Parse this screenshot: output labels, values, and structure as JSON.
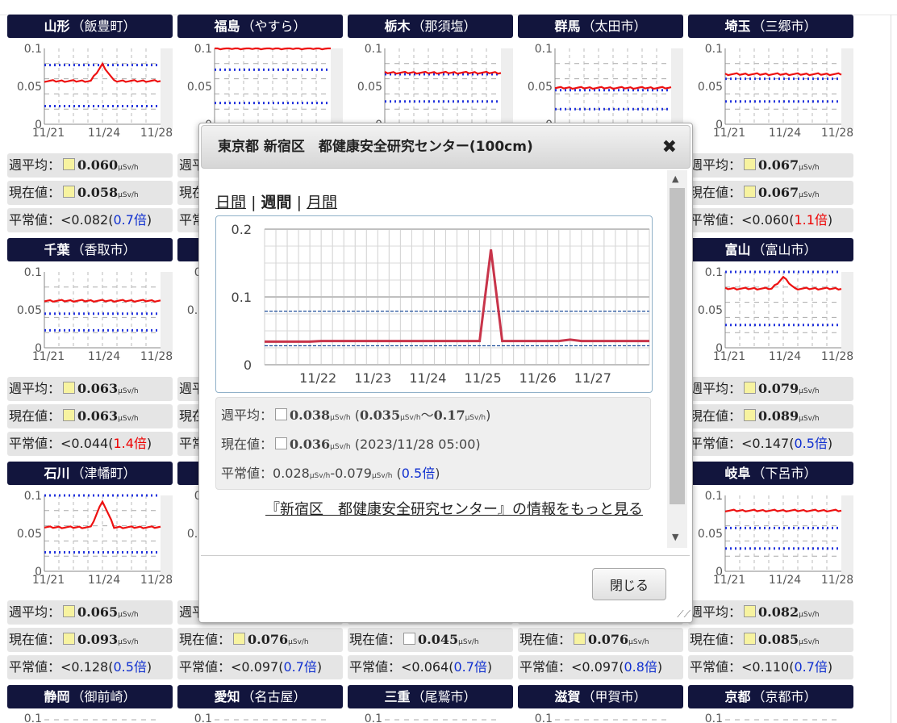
{
  "labels": {
    "avg": "週平均：",
    "cur": "現在値：",
    "norm": "平常値：",
    "unit": "μSv/h",
    "times": "倍"
  },
  "axis": {
    "y_ticks": [
      "0.1",
      "0.05",
      "0"
    ],
    "x_ticks": [
      "11/21",
      "11/24",
      "11/28"
    ]
  },
  "cards": [
    {
      "pref": "山形",
      "city": "（飯豊町）",
      "avg": "0.060",
      "cur": "0.058",
      "avg_sq": "yellow",
      "cur_sq": "yellow",
      "norm": "<0.082(",
      "ratio": "0.7倍",
      "ratio_color": "blue",
      "close": ")",
      "line": {
        "level": 0.057,
        "spike": {
          "pos": 0.5,
          "height": 0.022
        }
      },
      "bands": [
        0.078,
        0.024
      ]
    },
    {
      "pref": "福島",
      "city": "（やすら）",
      "avg": "",
      "cur": "",
      "norm": "",
      "ratio": "",
      "close": "",
      "line": {
        "level": 0.1
      },
      "bands": [
        0.072,
        0.028
      ]
    },
    {
      "pref": "栃木",
      "city": "（那須塩）",
      "avg": "",
      "cur": "",
      "norm": "",
      "ratio": "",
      "close": "",
      "line": {
        "level": 0.068
      },
      "bands": [
        0.066,
        0.03
      ]
    },
    {
      "pref": "群馬",
      "city": "（太田市）",
      "avg": "",
      "cur": "",
      "norm": "",
      "ratio": "",
      "close": "",
      "line": {
        "level": 0.048
      },
      "bands": [
        0.045,
        0.02
      ]
    },
    {
      "pref": "埼玉",
      "city": "（三郷市）",
      "avg": "0.067",
      "cur": "0.067",
      "avg_sq": "yellow",
      "cur_sq": "yellow",
      "norm": "<0.060(",
      "ratio": "1.1倍",
      "ratio_color": "red",
      "close": ")",
      "line": {
        "level": 0.066
      },
      "bands": [
        0.06,
        0.03
      ]
    },
    {
      "pref": "千葉",
      "city": "（香取市）",
      "avg": "0.063",
      "cur": "0.063",
      "avg_sq": "yellow",
      "cur_sq": "yellow",
      "norm": "<0.044(",
      "ratio": "1.4倍",
      "ratio_color": "red",
      "close": ")",
      "line": {
        "level": 0.062
      },
      "bands": [
        0.045,
        0.023
      ]
    },
    {
      "pref": "",
      "city": "",
      "avg": "",
      "cur": "",
      "norm": "",
      "ratio": "",
      "close": "",
      "line": {
        "level": 0.06
      },
      "bands": [
        0.05,
        0.02
      ]
    },
    {
      "pref": "",
      "city": "",
      "avg": "",
      "cur": "",
      "norm": "",
      "ratio": "",
      "close": "",
      "line": {
        "level": 0.06
      },
      "bands": [
        0.05,
        0.02
      ]
    },
    {
      "pref": "",
      "city": "",
      "avg": "",
      "cur": "",
      "norm": "",
      "ratio": "",
      "close": "",
      "line": {
        "level": 0.06
      },
      "bands": [
        0.05,
        0.02
      ]
    },
    {
      "pref": "富山",
      "city": "（富山市）",
      "avg": "0.079",
      "cur": "0.089",
      "avg_sq": "yellow",
      "cur_sq": "yellow",
      "norm": "<0.147(",
      "ratio": "0.5倍",
      "ratio_color": "blue",
      "close": ")",
      "line": {
        "level": 0.078,
        "spike": {
          "pos": 0.5,
          "height": 0.015
        }
      },
      "bands": [
        0.1,
        0.03
      ]
    },
    {
      "pref": "石川",
      "city": "（津幡町）",
      "avg": "0.065",
      "cur": "0.093",
      "avg_sq": "yellow",
      "cur_sq": "yellow",
      "norm": "<0.128(",
      "ratio": "0.5倍",
      "ratio_color": "blue",
      "close": ")",
      "line": {
        "level": 0.058,
        "spike": {
          "pos": 0.5,
          "height": 0.035
        }
      },
      "bands": [
        0.1,
        0.025
      ]
    },
    {
      "pref": "",
      "city": "",
      "avg": "",
      "cur": "0.076",
      "avg_sq": "",
      "cur_sq": "yellow",
      "norm": "<0.097(",
      "ratio": "0.7倍",
      "ratio_color": "blue",
      "close": ")",
      "line": {
        "level": 0.06
      },
      "bands": [
        0.05,
        0.02
      ]
    },
    {
      "pref": "",
      "city": "",
      "avg": "",
      "cur": "0.045",
      "avg_sq": "",
      "cur_sq": "white",
      "norm": "<0.064(",
      "ratio": "0.7倍",
      "ratio_color": "blue",
      "close": ")",
      "line": {
        "level": 0.06
      },
      "bands": [
        0.05,
        0.02
      ]
    },
    {
      "pref": "",
      "city": "",
      "avg": "",
      "cur": "0.076",
      "avg_sq": "",
      "cur_sq": "yellow",
      "norm": "<0.097(",
      "ratio": "0.8倍",
      "ratio_color": "blue",
      "close": ")",
      "line": {
        "level": 0.06
      },
      "bands": [
        0.05,
        0.02
      ]
    },
    {
      "pref": "岐阜",
      "city": "（下呂市）",
      "avg": "0.082",
      "cur": "0.085",
      "avg_sq": "yellow",
      "cur_sq": "yellow",
      "norm": "<0.110(",
      "ratio": "0.7倍",
      "ratio_color": "blue",
      "close": ")",
      "line": {
        "level": 0.08
      },
      "bands": [
        0.057,
        0.03
      ]
    }
  ],
  "bottom_row": [
    {
      "pref": "静岡",
      "city": "（御前崎）"
    },
    {
      "pref": "愛知",
      "city": "（名古屋）"
    },
    {
      "pref": "三重",
      "city": "（尾鷲市）"
    },
    {
      "pref": "滋賀",
      "city": "（甲賀市）"
    },
    {
      "pref": "京都",
      "city": "（京都市）"
    }
  ],
  "modal": {
    "title": "東京都 新宿区　都健康安全研究センター(100cm)",
    "close": "✖",
    "tab_day": "日間",
    "tab_week": "週間",
    "tab_month": "月間",
    "sep": "|",
    "avg_label": "週平均：",
    "avg_val": "0.038",
    "avg_min": "0.035",
    "avg_max": "0.17",
    "cur_label": "現在値：",
    "cur_val": "0.036",
    "cur_time": "(2023/11/28 05:00)",
    "norm_label": "平常値：",
    "norm_low": "0.028",
    "norm_high": "0.079",
    "norm_ratio": "0.5倍",
    "unit": "μSv/h",
    "more_link": "『新宿区　都健康安全研究センター』の情報をもっと見る",
    "close_button": "閉じる"
  },
  "chart_data": {
    "type": "line",
    "y_ticks": [
      "0.2",
      "0.1",
      "0"
    ],
    "x_ticks": [
      "11/22",
      "11/23",
      "11/24",
      "11/25",
      "11/26",
      "11/27"
    ],
    "ylim": [
      0,
      0.2
    ],
    "series": [
      {
        "values": [
          0.034,
          0.034,
          0.034,
          0.034,
          0.034,
          0.035,
          0.035,
          0.035,
          0.035,
          0.035,
          0.035,
          0.035,
          0.035,
          0.035,
          0.035,
          0.035,
          0.035,
          0.035,
          0.035,
          0.035,
          0.17,
          0.035,
          0.035,
          0.035,
          0.035,
          0.035,
          0.035,
          0.037,
          0.035,
          0.035,
          0.035,
          0.035,
          0.035,
          0.035,
          0.035
        ]
      }
    ],
    "bands": [
      0.079,
      0.028
    ],
    "colors": {
      "line": "#c8344a",
      "band": "#1f4e9a"
    }
  }
}
